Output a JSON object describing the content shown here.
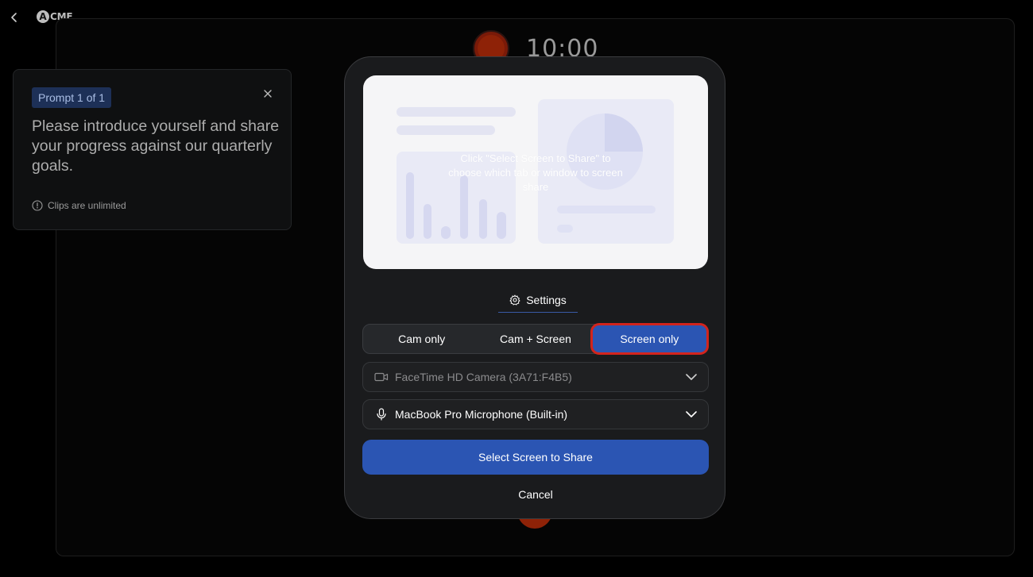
{
  "header": {
    "back_icon": "chevron-left-icon",
    "logo_mark": "A",
    "logo_text": "CME"
  },
  "recording": {
    "timer": "10:00"
  },
  "prompt": {
    "badge": "Prompt 1 of 1",
    "text": "Please introduce yourself and share your progress against our quarterly goals.",
    "meta": "Clips are unlimited",
    "close_icon": "close-icon",
    "info_icon": "info-icon"
  },
  "modal": {
    "preview_text": "Click \"Select Screen to Share\" to choose which tab or window to screen share",
    "settings_label": "Settings",
    "modes": [
      "Cam only",
      "Cam + Screen",
      "Screen only"
    ],
    "active_mode": "Screen only",
    "camera": "FaceTime HD Camera (3A71:F4B5)",
    "microphone": "MacBook Pro Microphone (Built-in)",
    "primary_button": "Select Screen to Share",
    "cancel_button": "Cancel"
  },
  "colors": {
    "accent": "#2b55b3",
    "highlight_ring": "#d2241d",
    "record": "#8e2207",
    "badge_bg": "#1d3057"
  }
}
